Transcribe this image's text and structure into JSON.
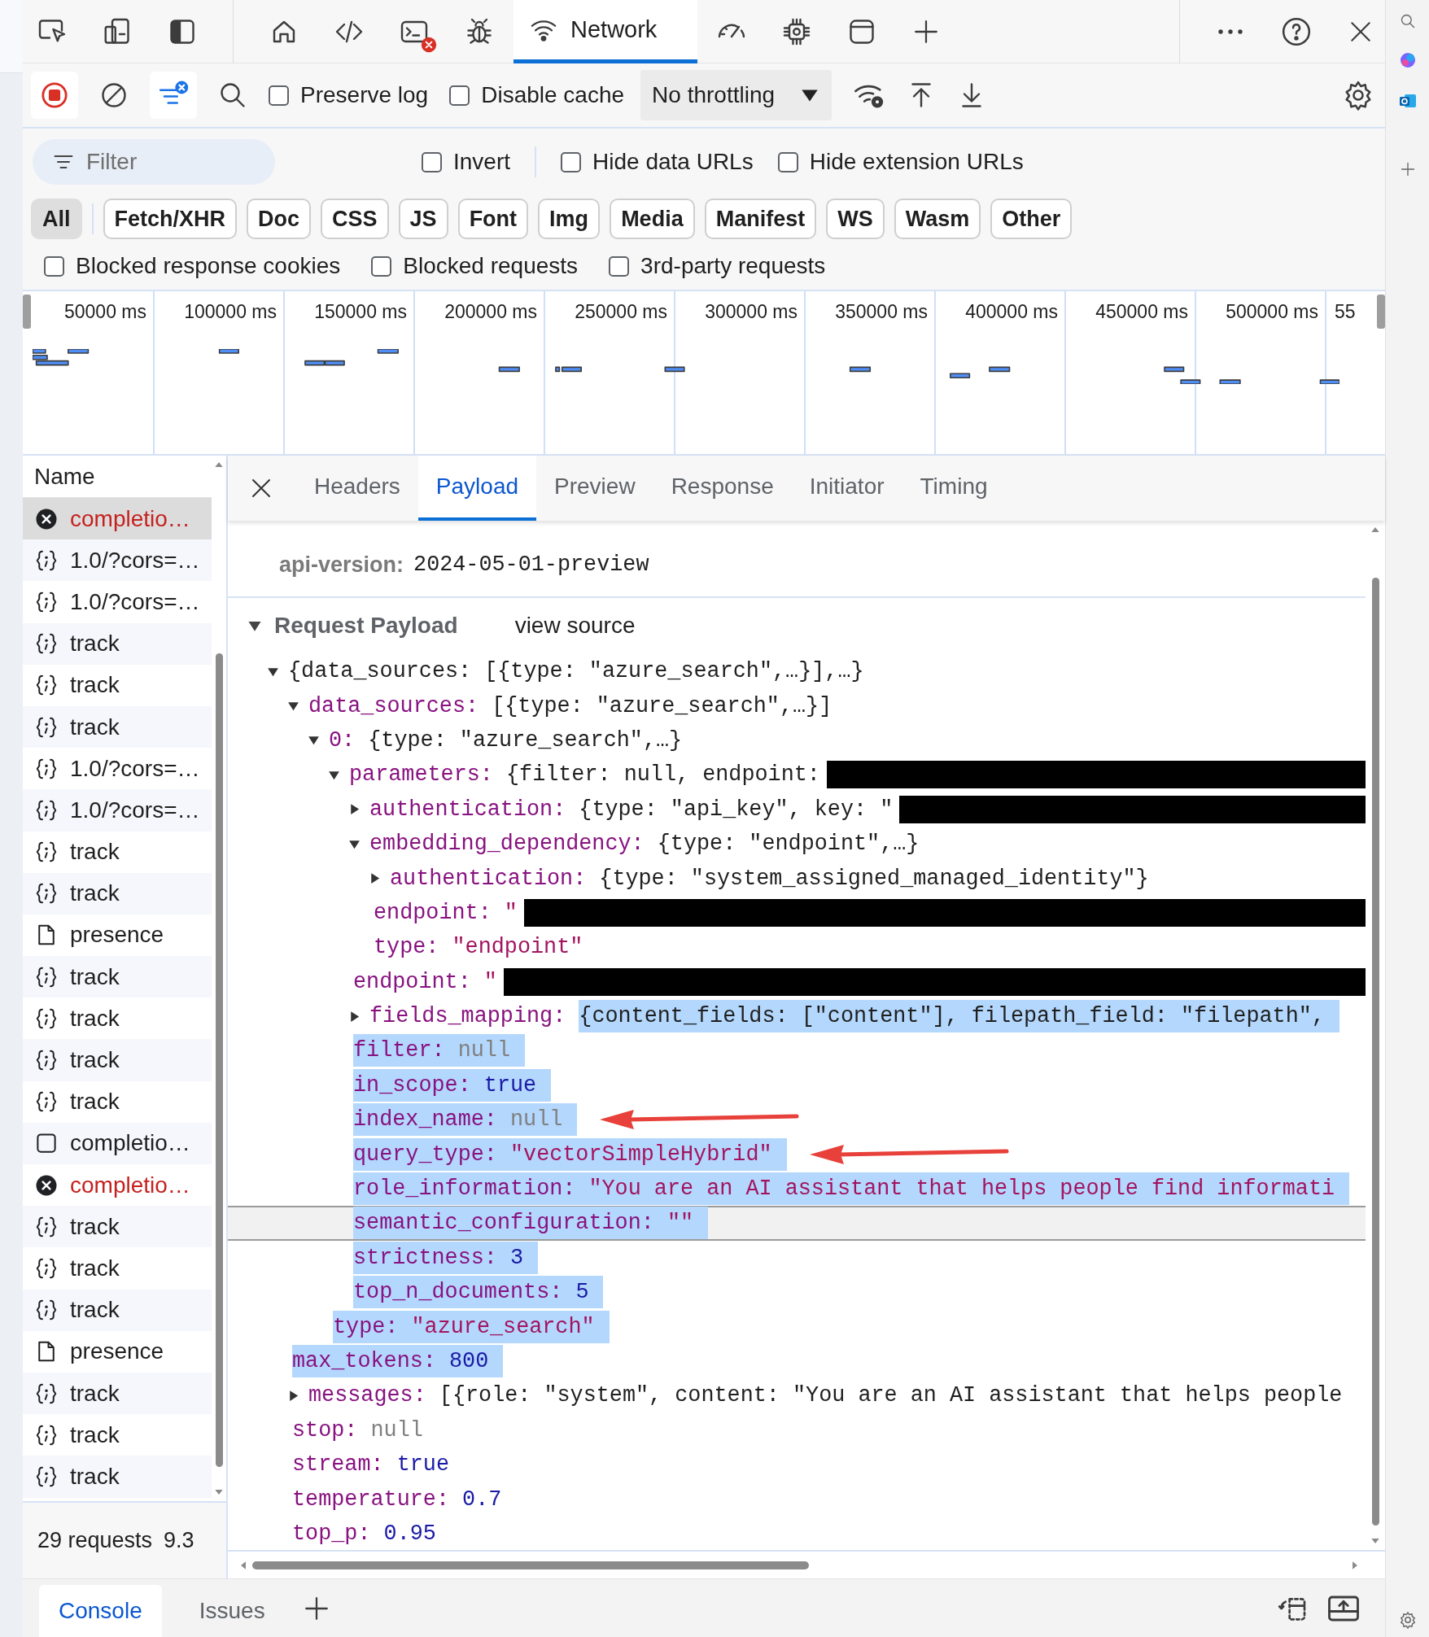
{
  "panel_tabs": [
    {
      "selected": false,
      "error_badge": false
    },
    {
      "selected": false,
      "error_badge": false
    },
    {
      "selected": false,
      "error_badge": true
    },
    {
      "selected": false,
      "error_badge": false
    },
    {
      "label": "Network",
      "selected": true,
      "error_badge": false
    },
    {
      "selected": false,
      "error_badge": false
    },
    {
      "selected": false,
      "error_badge": false
    },
    {
      "selected": false,
      "error_badge": false
    }
  ],
  "toolbar": {
    "recording": true,
    "filter_bar_shown": true,
    "checkboxes": [
      {
        "label": "Preserve log",
        "checked": false
      },
      {
        "label": "Disable cache",
        "checked": false
      }
    ],
    "throttling": {
      "value": "No throttling"
    }
  },
  "filter": {
    "placeholder": "Filter",
    "checkboxes": [
      {
        "label": "Invert",
        "checked": false
      },
      {
        "label": "Hide data URLs",
        "checked": false
      },
      {
        "label": "Hide extension URLs",
        "checked": false
      }
    ]
  },
  "type_chips": [
    {
      "label": "All",
      "selected": true
    },
    {
      "label": "Fetch/XHR",
      "selected": false
    },
    {
      "label": "Doc",
      "selected": false
    },
    {
      "label": "CSS",
      "selected": false
    },
    {
      "label": "JS",
      "selected": false
    },
    {
      "label": "Font",
      "selected": false
    },
    {
      "label": "Img",
      "selected": false
    },
    {
      "label": "Media",
      "selected": false
    },
    {
      "label": "Manifest",
      "selected": false
    },
    {
      "label": "WS",
      "selected": false
    },
    {
      "label": "Wasm",
      "selected": false
    },
    {
      "label": "Other",
      "selected": false
    }
  ],
  "blocked_checkboxes": [
    {
      "label": "Blocked response cookies",
      "checked": false
    },
    {
      "label": "Blocked requests",
      "checked": false
    },
    {
      "label": "3rd-party requests",
      "checked": false
    }
  ],
  "timeline": {
    "ticks": [
      "50000 ms",
      "100000 ms",
      "150000 ms",
      "200000 ms",
      "250000 ms",
      "300000 ms",
      "350000 ms",
      "400000 ms",
      "450000 ms",
      "500000 ms",
      "55"
    ]
  },
  "requests": {
    "header": "Name",
    "rows": [
      {
        "name": "completio…",
        "kind": "error",
        "failed": true,
        "selected": true
      },
      {
        "name": "1.0/?cors=…",
        "kind": "fetch",
        "failed": false,
        "selected": false
      },
      {
        "name": "1.0/?cors=…",
        "kind": "fetch",
        "failed": false,
        "selected": false
      },
      {
        "name": "track",
        "kind": "fetch",
        "failed": false,
        "selected": false
      },
      {
        "name": "track",
        "kind": "fetch",
        "failed": false,
        "selected": false
      },
      {
        "name": "track",
        "kind": "fetch",
        "failed": false,
        "selected": false
      },
      {
        "name": "1.0/?cors=…",
        "kind": "fetch",
        "failed": false,
        "selected": false
      },
      {
        "name": "1.0/?cors=…",
        "kind": "fetch",
        "failed": false,
        "selected": false
      },
      {
        "name": "track",
        "kind": "fetch",
        "failed": false,
        "selected": false
      },
      {
        "name": "track",
        "kind": "fetch",
        "failed": false,
        "selected": false
      },
      {
        "name": "presence",
        "kind": "doc",
        "failed": false,
        "selected": false
      },
      {
        "name": "track",
        "kind": "fetch",
        "failed": false,
        "selected": false
      },
      {
        "name": "track",
        "kind": "fetch",
        "failed": false,
        "selected": false
      },
      {
        "name": "track",
        "kind": "fetch",
        "failed": false,
        "selected": false
      },
      {
        "name": "track",
        "kind": "fetch",
        "failed": false,
        "selected": false
      },
      {
        "name": "completio…",
        "kind": "blank",
        "failed": false,
        "selected": false
      },
      {
        "name": "completio…",
        "kind": "error",
        "failed": true,
        "selected": false
      },
      {
        "name": "track",
        "kind": "fetch",
        "failed": false,
        "selected": false
      },
      {
        "name": "track",
        "kind": "fetch",
        "failed": false,
        "selected": false
      },
      {
        "name": "track",
        "kind": "fetch",
        "failed": false,
        "selected": false
      },
      {
        "name": "presence",
        "kind": "doc",
        "failed": false,
        "selected": false
      },
      {
        "name": "track",
        "kind": "fetch",
        "failed": false,
        "selected": false
      },
      {
        "name": "track",
        "kind": "fetch",
        "failed": false,
        "selected": false
      },
      {
        "name": "track",
        "kind": "fetch",
        "failed": false,
        "selected": false
      }
    ],
    "summary": [
      "29 requests",
      "9.3"
    ]
  },
  "detail": {
    "tabs": [
      {
        "label": "Headers",
        "selected": false
      },
      {
        "label": "Payload",
        "selected": true
      },
      {
        "label": "Preview",
        "selected": false
      },
      {
        "label": "Response",
        "selected": false
      },
      {
        "label": "Initiator",
        "selected": false
      },
      {
        "label": "Timing",
        "selected": false
      }
    ],
    "query_params": [
      {
        "key": "api-version:",
        "value": "2024-05-01-preview"
      }
    ],
    "payload": {
      "title": "Request Payload",
      "view_source": "view source",
      "expanded": true,
      "tree": {
        "value": "{data_sources: [{type: \"azure_search\",…}],…}",
        "kind": "summary",
        "expanded": true,
        "value_selected": false,
        "children": [
          {
            "key": "data_sources:",
            "value": "[{type: \"azure_search\",…}]",
            "kind": "summary",
            "expanded": true,
            "key_selected": false,
            "value_selected": false,
            "children": [
              {
                "key": "0:",
                "value": "{type: \"azure_search\",…}",
                "kind": "summary",
                "expanded": true,
                "key_selected": false,
                "value_selected": false,
                "children": [
                  {
                    "key": "parameters:",
                    "value": "{filter: null, endpoint:",
                    "kind": "summary",
                    "expanded": true,
                    "redacted": true,
                    "key_selected": false,
                    "value_selected": false,
                    "children": [
                      {
                        "key": "authentication:",
                        "value": "{type: \"api_key\", key: \"",
                        "kind": "summary",
                        "expanded": false,
                        "redacted": true,
                        "key_selected": false,
                        "value_selected": false
                      },
                      {
                        "key": "embedding_dependency:",
                        "value": "{type: \"endpoint\",…}",
                        "kind": "summary",
                        "expanded": true,
                        "key_selected": false,
                        "value_selected": false,
                        "children": [
                          {
                            "key": "authentication:",
                            "value": "{type: \"system_assigned_managed_identity\"}",
                            "kind": "summary",
                            "expanded": false,
                            "key_selected": false,
                            "value_selected": false
                          },
                          {
                            "key": "endpoint:",
                            "value": "\"",
                            "kind": "string",
                            "redacted": true,
                            "key_selected": false,
                            "value_selected": false
                          },
                          {
                            "key": "type:",
                            "value": "\"endpoint\"",
                            "kind": "string",
                            "key_selected": false,
                            "value_selected": false
                          }
                        ]
                      },
                      {
                        "key": "endpoint:",
                        "value": "\"",
                        "kind": "string",
                        "redacted": true,
                        "key_selected": false,
                        "value_selected": false
                      },
                      {
                        "key": "fields_mapping:",
                        "value": "{content_fields: [\"content\"], filepath_field: \"filepath\",",
                        "kind": "summary",
                        "expanded": false,
                        "key_selected": false,
                        "value_selected": true
                      },
                      {
                        "key": "filter:",
                        "value": "null",
                        "kind": "null",
                        "key_selected": true,
                        "value_selected": true
                      },
                      {
                        "key": "in_scope:",
                        "value": "true",
                        "kind": "bool",
                        "key_selected": true,
                        "value_selected": true
                      },
                      {
                        "key": "index_name:",
                        "value": "null",
                        "kind": "null",
                        "key_selected": true,
                        "value_selected": true,
                        "arrow": true
                      },
                      {
                        "key": "query_type:",
                        "value": "\"vectorSimpleHybrid\"",
                        "kind": "string",
                        "key_selected": true,
                        "value_selected": true,
                        "arrow": true
                      },
                      {
                        "key": "role_information:",
                        "value": "\"You are an AI assistant that helps people find informati",
                        "kind": "string",
                        "key_selected": true,
                        "value_selected": true
                      },
                      {
                        "key": "semantic_configuration:",
                        "value": "\"\"",
                        "kind": "string",
                        "key_selected": true,
                        "value_selected": true,
                        "hovered": true
                      },
                      {
                        "key": "strictness:",
                        "value": "3",
                        "kind": "number",
                        "key_selected": true,
                        "value_selected": true
                      },
                      {
                        "key": "top_n_documents:",
                        "value": "5",
                        "kind": "number",
                        "key_selected": true,
                        "value_selected": true
                      }
                    ]
                  },
                  {
                    "key": "type:",
                    "value": "\"azure_search\"",
                    "kind": "string",
                    "key_selected": true,
                    "value_selected": true
                  }
                ]
              }
            ]
          },
          {
            "key": "max_tokens:",
            "value": "800",
            "kind": "number",
            "key_selected": true,
            "value_selected": true
          },
          {
            "key": "messages:",
            "value": "[{role: \"system\", content: \"You are an AI assistant that helps people",
            "kind": "summary",
            "expanded": false,
            "key_selected": false,
            "value_selected": false
          },
          {
            "key": "stop:",
            "value": "null",
            "kind": "null",
            "key_selected": false,
            "value_selected": false
          },
          {
            "key": "stream:",
            "value": "true",
            "kind": "bool",
            "key_selected": false,
            "value_selected": false
          },
          {
            "key": "temperature:",
            "value": "0.7",
            "kind": "number",
            "key_selected": false,
            "value_selected": false
          },
          {
            "key": "top_p:",
            "value": "0.95",
            "kind": "number",
            "key_selected": false,
            "value_selected": false
          }
        ]
      }
    }
  },
  "drawer": {
    "tabs": [
      {
        "label": "Console",
        "selected": true
      },
      {
        "label": "Issues",
        "selected": false
      }
    ]
  }
}
